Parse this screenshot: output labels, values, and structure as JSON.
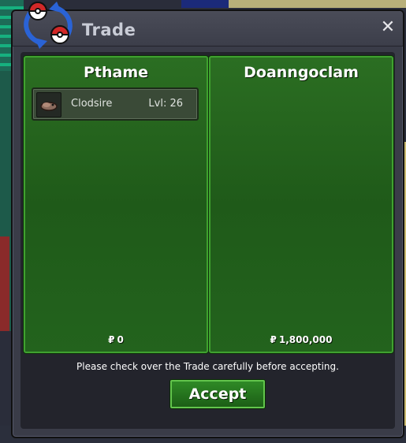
{
  "window": {
    "title": "Trade",
    "close_symbol": "✕",
    "logo_icon": "trade-swap-pokeball-icon"
  },
  "trade": {
    "left": {
      "player_name": "Pthame",
      "currency_symbol": "₽",
      "money_offer": "0",
      "items": [
        {
          "name": "Clodsire",
          "level": "Lvl: 26",
          "icon": "clodsire-sprite-icon"
        }
      ]
    },
    "right": {
      "player_name": "Doanngoclam",
      "currency_symbol": "₽",
      "money_offer": "1,800,000",
      "items": []
    }
  },
  "footer": {
    "note": "Please check over the Trade carefully before accepting.",
    "accept_label": "Accept"
  },
  "colors": {
    "panel_green": "#236a1e",
    "panel_border": "#3fa22f",
    "window_bg": "#3a3c48",
    "accent_red": "#d22828",
    "accent_blue": "#2a63d6"
  }
}
